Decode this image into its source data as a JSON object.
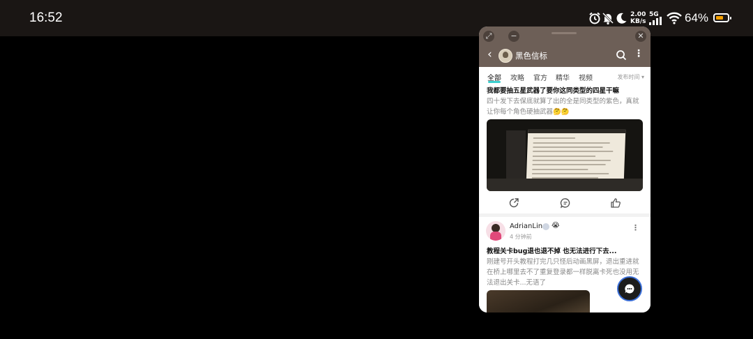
{
  "status_bar": {
    "time": "16:52",
    "net_speed_value": "2.00",
    "net_speed_unit": "KB/s",
    "network": "5G",
    "battery_percent": "64%",
    "icons": [
      "alarm-icon",
      "mute-icon",
      "do-not-disturb-moon-icon",
      "signal-icon",
      "wifi-icon",
      "battery-icon"
    ],
    "battery_color": "#f5a000"
  },
  "window": {
    "controls": [
      "expand-icon",
      "minimize-icon",
      "close-icon"
    ],
    "header": {
      "title": "黑色信标",
      "icons": [
        "back-icon",
        "search-icon",
        "more-icon"
      ]
    },
    "tabs": [
      "全部",
      "攻略",
      "官方",
      "精华",
      "视频"
    ],
    "active_tab": "全部",
    "sort_label": "发布时间 ▾",
    "accent_color": "#3ccfcf"
  },
  "post1": {
    "title": "我都要抽五星武器了要你这同类型的四星干嘛",
    "text": "四十发下去保底就算了出的全是同类型的紫色，真就让你每个角色硬抽武器🤔🤔",
    "actions": [
      "share-icon",
      "comment-icon",
      "like-icon"
    ]
  },
  "post2": {
    "username": "AdrianLin",
    "emoji": "😭",
    "time_ago": "4 分钟前",
    "title": "教程关卡bug退也退不掉 也无法进行下去...",
    "text": "刚建号开头教程打完几只怪后动画黑屏，退出重进就在桥上哪里去不了重复登录都一样脱离卡死也没用无法退出关卡...无语了"
  }
}
